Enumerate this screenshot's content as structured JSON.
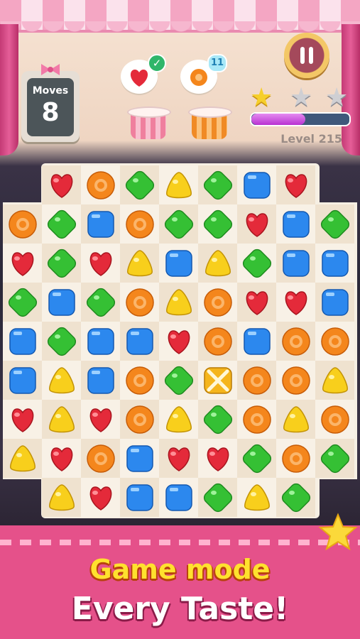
{
  "hud": {
    "moves_label": "Moves",
    "moves_value": "8",
    "goals": [
      {
        "piece": "heart",
        "status": "completed"
      },
      {
        "piece": "ring",
        "remaining": "11"
      }
    ],
    "stars_earned": 1,
    "stars_total": 3,
    "level_progress_fraction": 0.55,
    "level_label": "Level 215",
    "pause_icon": "pause-icon"
  },
  "piece_colors": {
    "heart": "#e42a3a",
    "ring": "#f4861c",
    "green": "#35c034",
    "blue": "#2c88ee",
    "yellow": "#f8cf1c",
    "special": "#f5b51c"
  },
  "board": {
    "columns": 9,
    "rows": 9,
    "grid": [
      [
        null,
        "heart",
        "ring",
        "green",
        "yellow",
        "green",
        "blue",
        "heart",
        null
      ],
      [
        "ring",
        "green",
        "blue",
        "ring",
        "green",
        "green",
        "heart",
        "blue",
        "green"
      ],
      [
        "heart",
        "green",
        "heart",
        "yellow",
        "blue",
        "yellow",
        "green",
        "blue",
        "blue"
      ],
      [
        "green",
        "blue",
        "green",
        "ring",
        "yellow",
        "ring",
        "heart",
        "heart",
        "blue"
      ],
      [
        "blue",
        "green",
        "blue",
        "blue",
        "heart",
        "ring",
        "blue",
        "ring",
        "ring"
      ],
      [
        "blue",
        "yellow",
        "blue",
        "ring",
        "green",
        "special",
        "ring",
        "ring",
        "yellow"
      ],
      [
        "heart",
        "yellow",
        "heart",
        "ring",
        "yellow",
        "green",
        "ring",
        "yellow",
        "ring"
      ],
      [
        "yellow",
        "heart",
        "ring",
        "blue",
        "heart",
        "heart",
        "green",
        "ring",
        "green"
      ],
      [
        null,
        "yellow",
        "heart",
        "blue",
        "blue",
        "green",
        "yellow",
        "green",
        null
      ]
    ]
  },
  "banner": {
    "line1": "Game mode",
    "line2": "Every Taste!"
  }
}
